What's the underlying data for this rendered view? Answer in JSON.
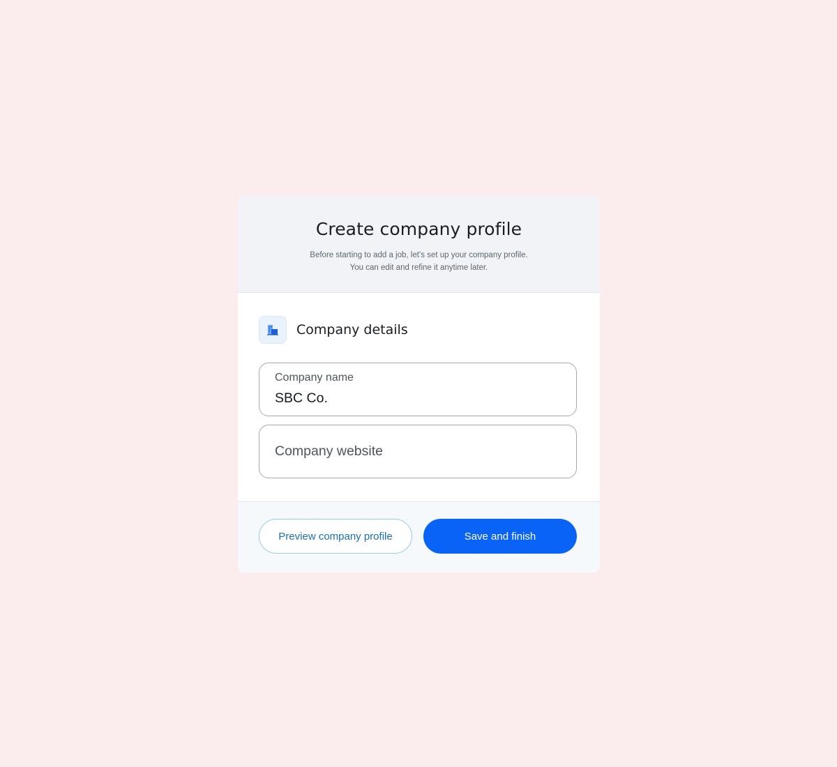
{
  "colors": {
    "page_background": "#fbecee",
    "primary": "#0a63f7",
    "secondary_border": "#97cbe4",
    "header_background": "#f1f3f6"
  },
  "dialog": {
    "title": "Create company profile",
    "subtitle_line1": "Before starting to add a job, let’s set up your company profile.",
    "subtitle_line2": "You can edit and refine it anytime later."
  },
  "section": {
    "icon": "building-icon",
    "title": "Company details"
  },
  "fields": {
    "company_name": {
      "label": "Company name",
      "value": "SBC Co."
    },
    "company_website": {
      "placeholder": "Company website",
      "value": ""
    }
  },
  "footer": {
    "preview_label": "Preview company profile",
    "save_label": "Save and finish"
  }
}
